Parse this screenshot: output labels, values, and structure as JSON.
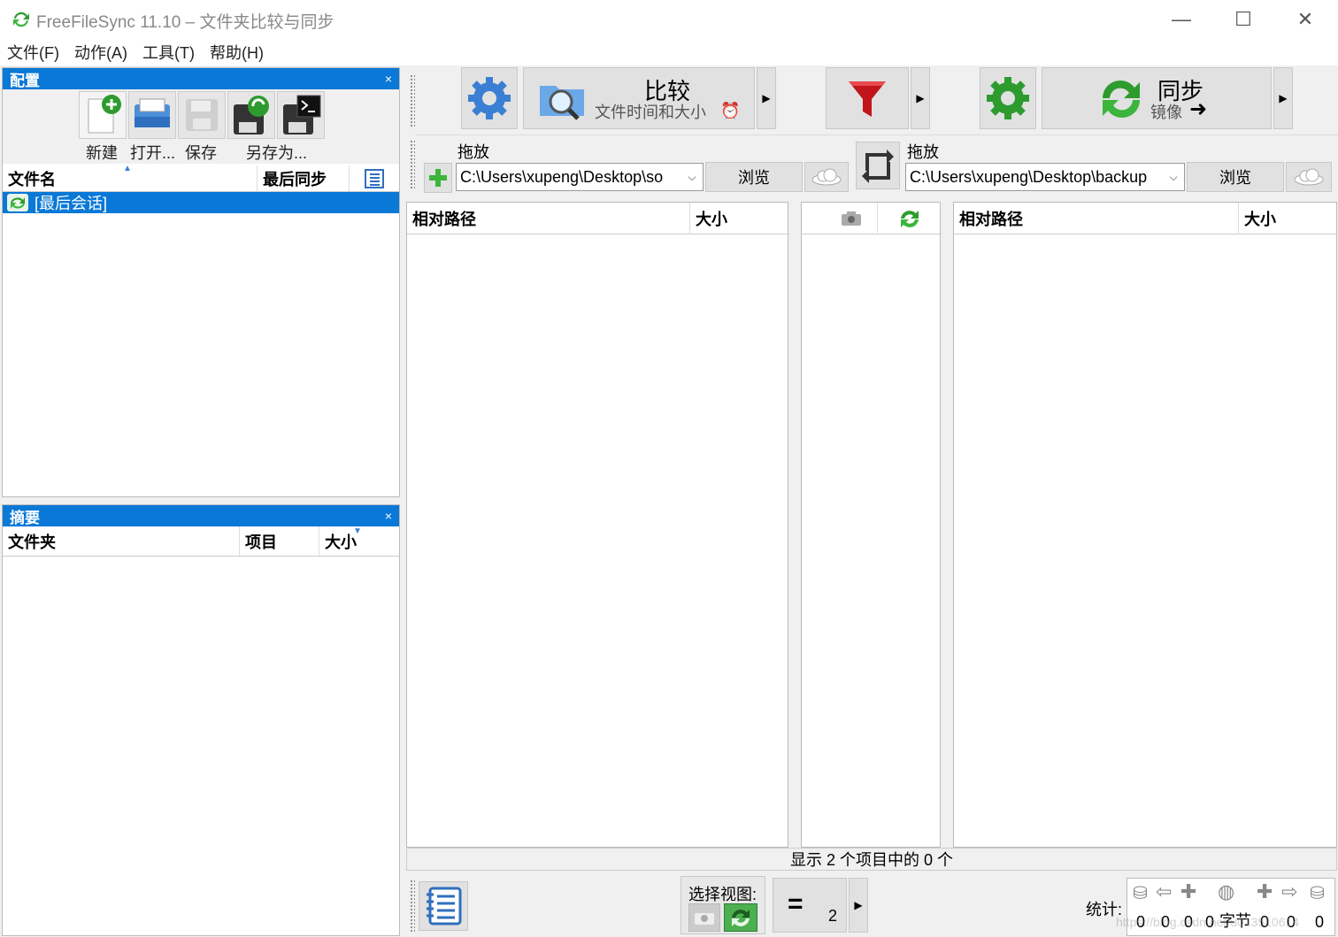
{
  "window": {
    "title": "FreeFileSync 11.10 – 文件夹比较与同步",
    "controls": {
      "minimize": "—",
      "maximize": "☐",
      "close": "✕"
    }
  },
  "menu": [
    "文件(F)",
    "动作(A)",
    "工具(T)",
    "帮助(H)"
  ],
  "config_pane": {
    "title": "配置",
    "close": "×",
    "tools": [
      {
        "label": "新建",
        "icon": "new-config-icon"
      },
      {
        "label": "打开...",
        "icon": "open-config-icon"
      },
      {
        "label": "保存",
        "icon": "save-config-icon"
      },
      {
        "label": "另存为...",
        "icon": "save-as-icon"
      },
      {
        "label": "",
        "icon": "save-batch-icon"
      }
    ],
    "columns": {
      "name": "文件名",
      "last_sync": "最后同步"
    },
    "items": [
      {
        "label": "[最后会话]",
        "selected": true
      }
    ]
  },
  "summary_pane": {
    "title": "摘要",
    "close": "×",
    "columns": {
      "folder": "文件夹",
      "items": "项目",
      "size": "大小"
    }
  },
  "toolbar": {
    "compare_label": "比较",
    "compare_sub": "文件时间和大小",
    "sync_label": "同步",
    "sync_sub": "镜像"
  },
  "left_folder": {
    "drop_label": "拖放",
    "path": "C:\\Users\\xupeng\\Desktop\\so",
    "browse": "浏览"
  },
  "right_folder": {
    "drop_label": "拖放",
    "path": "C:\\Users\\xupeng\\Desktop\\backup",
    "browse": "浏览"
  },
  "left_grid": {
    "col_path": "相对路径",
    "col_size": "大小"
  },
  "right_grid": {
    "col_path": "相对路径",
    "col_size": "大小"
  },
  "status": {
    "text": "显示 2 个项目中的 0 个"
  },
  "bottom": {
    "view_label": "选择视图:",
    "equal_count": "2",
    "stats_label": "统计:",
    "stats": [
      "0",
      "0",
      "0",
      "0",
      "字节",
      "0",
      "0",
      "0"
    ],
    "watermark": "https://blog.csdn.net/u013510614"
  },
  "colors": {
    "accent": "#0a78d7",
    "selection": "#0a78d7",
    "green": "#2e9b2e",
    "red": "#c0151a",
    "blue": "#3b7fd4"
  }
}
